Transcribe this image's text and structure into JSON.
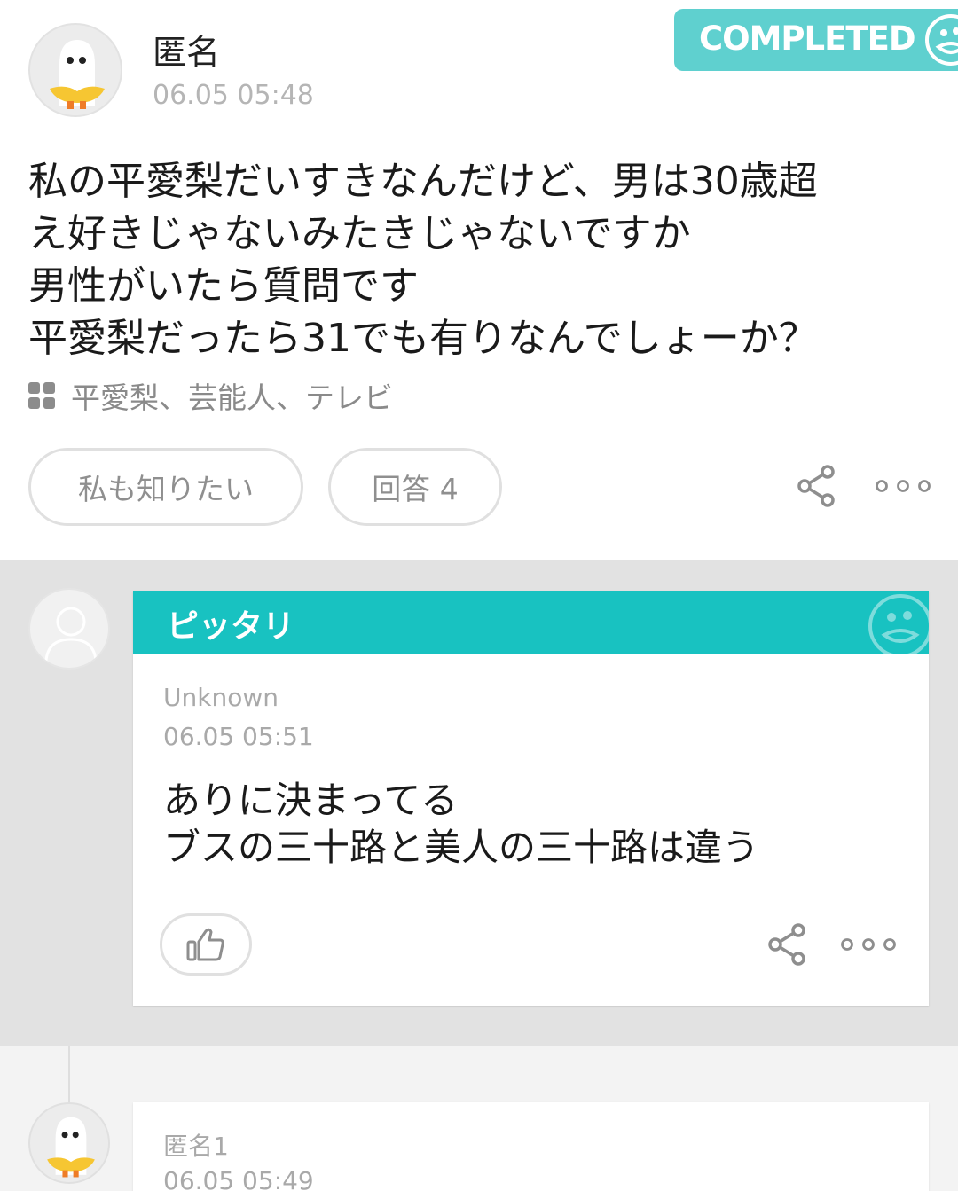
{
  "question": {
    "author": "匿名",
    "time": "06.05 05:48",
    "status_badge": "COMPLETED",
    "body_lines": [
      "私の平愛梨だいすきなんだけど、男は30歳超",
      "え好きじゃないみたきじゃないですか",
      "男性がいたら質問です",
      "平愛梨だったら31でも有りなんでしょーか？"
    ],
    "tags": "平愛梨、芸能人、テレビ",
    "want_to_know_label": "私も知りたい",
    "answers_label": "回答 4"
  },
  "best_answer": {
    "header_label": "ピッタリ",
    "author": "Unknown",
    "time": "06.05 05:51",
    "body_lines": [
      "ありに決まってる",
      "ブスの三十路と美人の三十路は違う"
    ]
  },
  "next_answer": {
    "author": "匿名1",
    "time": "06.05 05:49"
  },
  "colors": {
    "badge": "#5fd0cf",
    "best_header": "#18c2c1",
    "answer_bg": "#e2e2e2"
  },
  "icons": [
    "ghost-avatar-icon",
    "grid-icon",
    "share-icon",
    "more-icon",
    "default-user-icon",
    "thumbs-up-icon",
    "mascot-icon"
  ]
}
